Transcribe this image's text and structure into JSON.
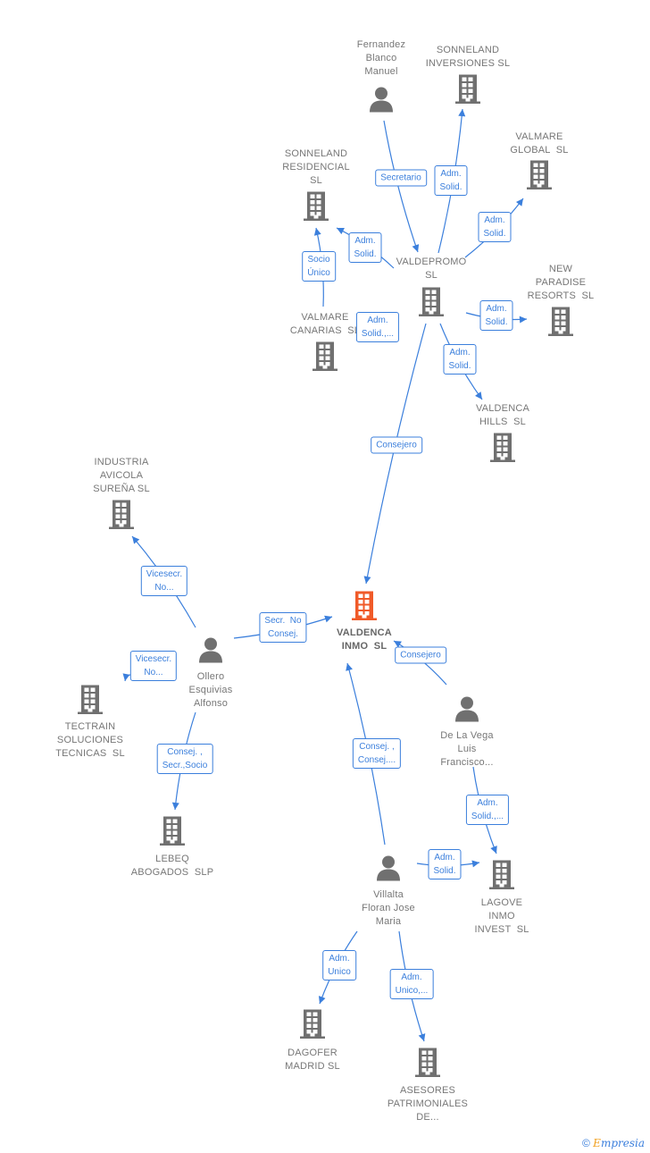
{
  "colors": {
    "edge": "#3b7fdc",
    "icon": "#707070",
    "focus": "#f05a28",
    "label": "#777777"
  },
  "nodes": [
    {
      "id": "fernandez",
      "type": "person",
      "label": "Fernandez\nBlanco\nManuel"
    },
    {
      "id": "sonneland_inv",
      "type": "company",
      "label": "SONNELAND\nINVERSIONES SL"
    },
    {
      "id": "valmare_global",
      "type": "company",
      "label": "VALMARE\nGLOBAL  SL"
    },
    {
      "id": "sonneland_res",
      "type": "company",
      "label": "SONNELAND\nRESIDENCIAL\nSL"
    },
    {
      "id": "valdepromo",
      "type": "company",
      "label": "VALDEPROMO\nSL"
    },
    {
      "id": "new_paradise",
      "type": "company",
      "label": "NEW\nPARADISE\nRESORTS  SL"
    },
    {
      "id": "valmare_canarias",
      "type": "company",
      "label": "VALMARE\nCANARIAS  SL"
    },
    {
      "id": "valdenca_hills",
      "type": "company",
      "label": "VALDENCA\nHILLS  SL"
    },
    {
      "id": "industria",
      "type": "company",
      "label": "INDUSTRIA\nAVICOLA\nSUREÑA SL"
    },
    {
      "id": "valdenca_inmo",
      "type": "focus",
      "label": "VALDENCA\nINMO  SL"
    },
    {
      "id": "ollero",
      "type": "person",
      "label": "Ollero\nEsquivias\nAlfonso"
    },
    {
      "id": "tectrain",
      "type": "company",
      "label": "TECTRAIN\nSOLUCIONES\nTECNICAS  SL"
    },
    {
      "id": "delavega",
      "type": "person",
      "label": "De La Vega\nLuis\nFrancisco..."
    },
    {
      "id": "lebeq",
      "type": "company",
      "label": "LEBEQ\nABOGADOS  SLP"
    },
    {
      "id": "villalta",
      "type": "person",
      "label": "Villalta\nFloran Jose\nMaria"
    },
    {
      "id": "lagove",
      "type": "company",
      "label": "LAGOVE\nINMO\nINVEST  SL"
    },
    {
      "id": "dagofer",
      "type": "company",
      "label": "DAGOFER\nMADRID SL"
    },
    {
      "id": "asesores",
      "type": "company",
      "label": "ASESORES\nPATRIMONIALES\nDE..."
    }
  ],
  "edges": [
    {
      "from": "fernandez",
      "to": "valdepromo",
      "label": "Secretario"
    },
    {
      "from": "valdepromo",
      "to": "sonneland_inv",
      "label": "Adm.\nSolid."
    },
    {
      "from": "valdepromo",
      "to": "valmare_global",
      "label": "Adm.\nSolid."
    },
    {
      "from": "valdepromo",
      "to": "sonneland_res",
      "label": "Adm.\nSolid."
    },
    {
      "from": "valmare_canarias",
      "to": "sonneland_res",
      "label": "Socio\nÚnico"
    },
    {
      "from": "valdepromo",
      "to": "valmare_canarias",
      "label": "Adm.\nSolid.,..."
    },
    {
      "from": "valdepromo",
      "to": "new_paradise",
      "label": "Adm.\nSolid."
    },
    {
      "from": "valdepromo",
      "to": "valdenca_hills",
      "label": "Adm.\nSolid."
    },
    {
      "from": "valdepromo",
      "to": "valdenca_inmo",
      "label": "Consejero"
    },
    {
      "from": "ollero",
      "to": "industria",
      "label": "Vicesecr.\nNo..."
    },
    {
      "from": "ollero",
      "to": "valdenca_inmo",
      "label": "Secr.  No\nConsej."
    },
    {
      "from": "ollero",
      "to": "tectrain",
      "label": "Vicesecr.\nNo..."
    },
    {
      "from": "ollero",
      "to": "lebeq",
      "label": "Consej. ,\nSecr.,Socio"
    },
    {
      "from": "delavega",
      "to": "valdenca_inmo",
      "label": "Consejero"
    },
    {
      "from": "delavega",
      "to": "lagove",
      "label": "Adm.\nSolid.,..."
    },
    {
      "from": "villalta",
      "to": "valdenca_inmo",
      "label": "Consej. ,\nConsej...."
    },
    {
      "from": "villalta",
      "to": "lagove",
      "label": "Adm.\nSolid."
    },
    {
      "from": "villalta",
      "to": "dagofer",
      "label": "Adm.\nUnico"
    },
    {
      "from": "villalta",
      "to": "asesores",
      "label": "Adm.\nUnico,..."
    }
  ],
  "footer": {
    "copyright": "©",
    "brand_initial": "E",
    "brand_rest": "mpresia"
  }
}
